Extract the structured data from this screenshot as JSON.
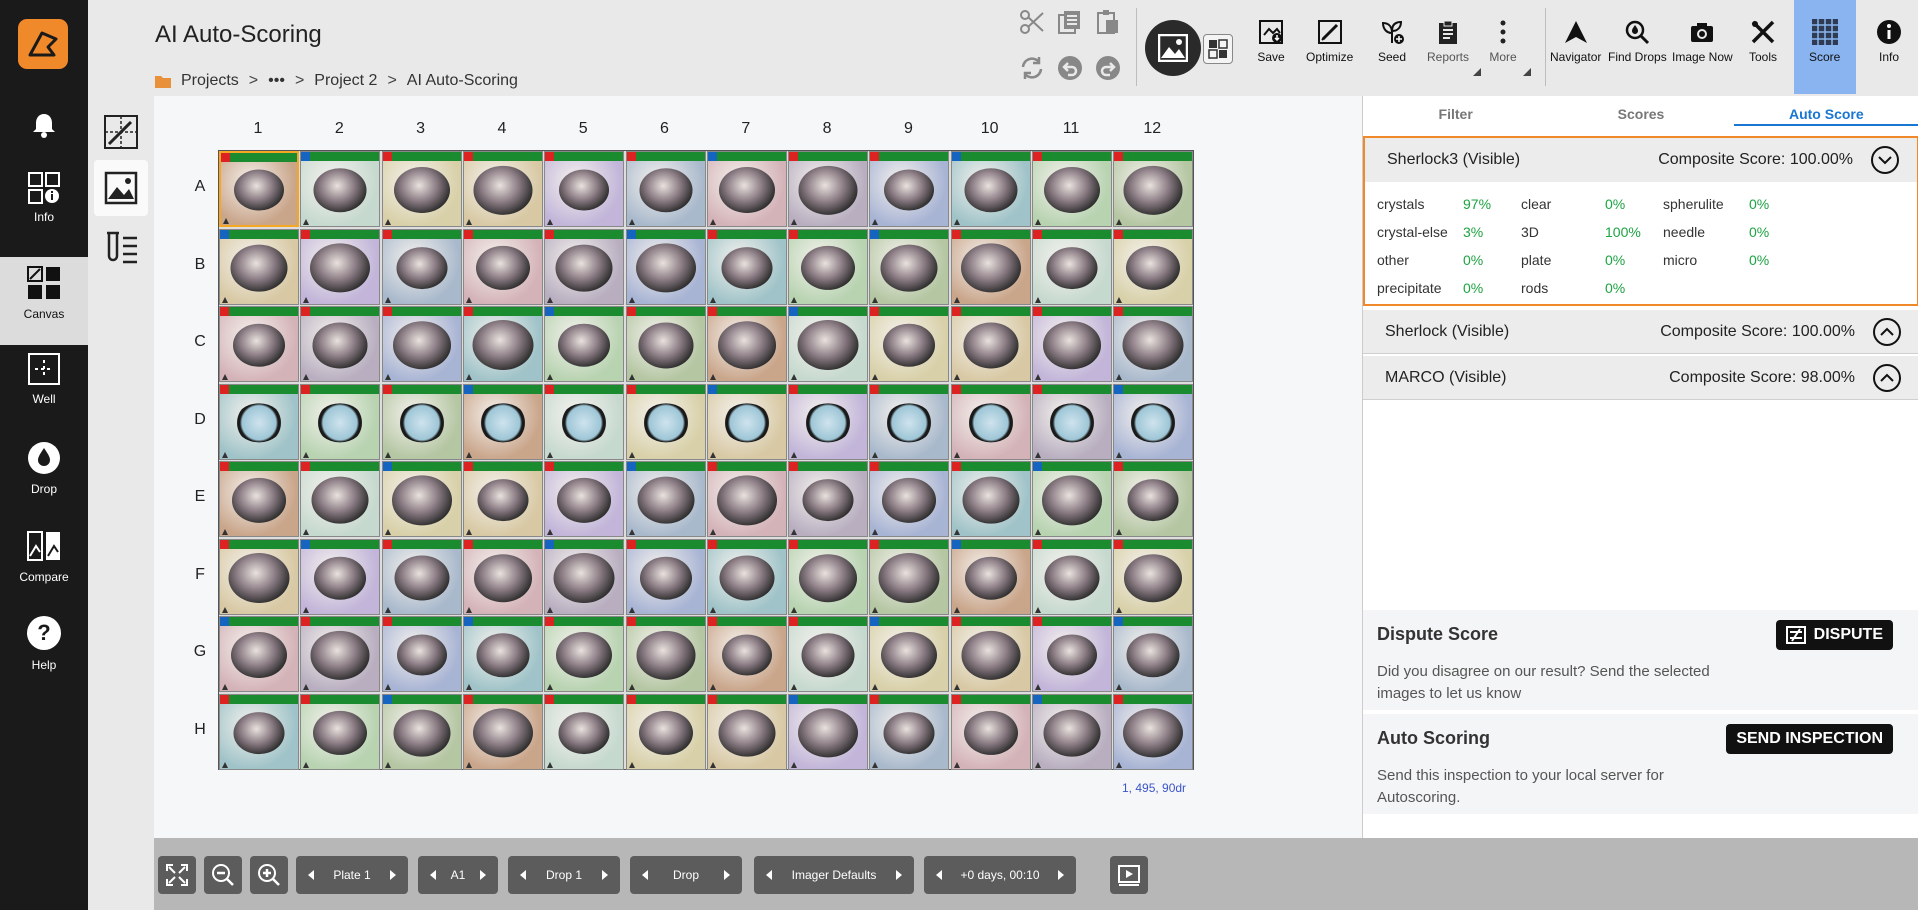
{
  "header": {
    "title": "AI Auto-Scoring",
    "breadcrumb": [
      "Projects",
      "•••",
      "Project 2",
      "AI Auto-Scoring"
    ],
    "breadcrumb_sep": ">"
  },
  "sidebar": {
    "items": [
      {
        "label": "",
        "icon": "bell-icon"
      },
      {
        "label": "Info",
        "icon": "info-grid-icon"
      },
      {
        "label": "Canvas",
        "icon": "canvas-icon",
        "active": true
      },
      {
        "label": "Well",
        "icon": "well-icon"
      },
      {
        "label": "Drop",
        "icon": "drop-icon"
      },
      {
        "label": "Compare",
        "icon": "compare-icon"
      },
      {
        "label": "Help",
        "icon": "help-icon"
      }
    ]
  },
  "toolbar": {
    "save": "Save",
    "optimize": "Optimize",
    "seed": "Seed",
    "reports": "Reports",
    "more": "More",
    "navigator": "Navigator",
    "find_drops": "Find Drops",
    "image_now": "Image Now",
    "tools": "Tools",
    "score": "Score",
    "info": "Info"
  },
  "plate": {
    "columns": [
      "1",
      "2",
      "3",
      "4",
      "5",
      "6",
      "7",
      "8",
      "9",
      "10",
      "11",
      "12"
    ],
    "rows": [
      "A",
      "B",
      "C",
      "D",
      "E",
      "F",
      "G",
      "H"
    ],
    "selected_well": "A1",
    "coord_readout": "1, 495, 90dr"
  },
  "panel": {
    "tabs": [
      "Filter",
      "Scores",
      "Auto Score"
    ],
    "active_tab": "Auto Score",
    "composite_label": "Composite Score:",
    "scorers": [
      {
        "name": "Sherlock3 (Visible)",
        "score": "100.00%",
        "expanded": true
      },
      {
        "name": "Sherlock (Visible)",
        "score": "100.00%",
        "expanded": false
      },
      {
        "name": "MARCO (Visible)",
        "score": "98.00%",
        "expanded": false
      }
    ],
    "classes": [
      {
        "name": "crystals",
        "value": "97%"
      },
      {
        "name": "crystal-else",
        "value": "3%"
      },
      {
        "name": "other",
        "value": "0%"
      },
      {
        "name": "precipitate",
        "value": "0%"
      },
      {
        "name": "clear",
        "value": "0%"
      },
      {
        "name": "3D",
        "value": "100%"
      },
      {
        "name": "plate",
        "value": "0%"
      },
      {
        "name": "rods",
        "value": "0%"
      },
      {
        "name": "spherulite",
        "value": "0%"
      },
      {
        "name": "needle",
        "value": "0%"
      },
      {
        "name": "micro",
        "value": "0%"
      }
    ],
    "dispute": {
      "title": "Dispute Score",
      "text": "Did you disagree on our result? Send the selected images to let us know",
      "button": "DISPUTE"
    },
    "auto_scoring": {
      "title": "Auto Scoring",
      "text": "Send this inspection to your local server for Autoscoring.",
      "button": "SEND INSPECTION"
    }
  },
  "bottom": {
    "plate": "Plate 1",
    "well": "A1",
    "drop": "Drop 1",
    "view": "Drop",
    "imager": "Imager Defaults",
    "time": "+0 days, 00:10"
  },
  "colors": {
    "accent": "#f0892a",
    "active_tab": "#1976d2",
    "score_active": "#8ab4f0",
    "positive_value": "#1da341"
  }
}
